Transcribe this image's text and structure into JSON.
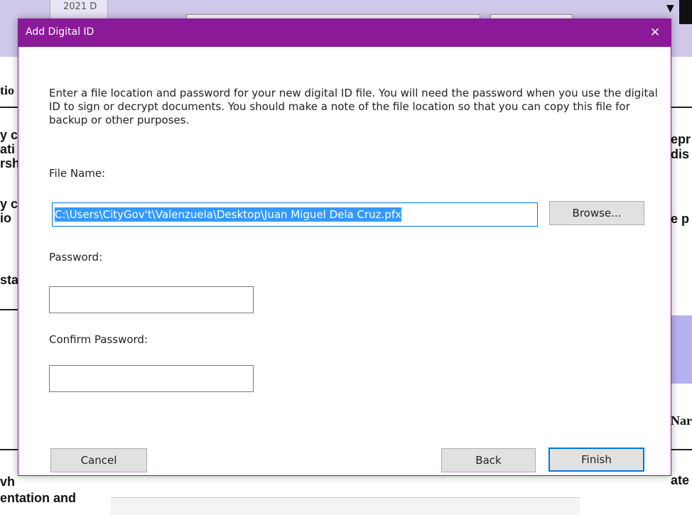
{
  "background": {
    "tab_label": "2021 D",
    "fragments_left": [
      "tio",
      "y c",
      "ati",
      "rsh",
      "y c",
      "io",
      "sta",
      "vh",
      "entation and"
    ],
    "fragments_right": [
      "epr",
      "dis",
      "e p",
      "Nar",
      "ate"
    ]
  },
  "dialog": {
    "title": "Add Digital ID",
    "close_glyph": "✕",
    "instructions": "Enter a file location and password for your new digital ID file. You will need the password when you use the digital ID to sign or decrypt documents. You should make a note of the file location so that you can copy this file for backup or other purposes.",
    "file_name_label": "File Name:",
    "file_name_value": "C:\\Users\\CityGov't\\Valenzuela\\Desktop\\Juan Miguel Dela Cruz.pfx",
    "browse_label": "Browse...",
    "password_label": "Password:",
    "password_value": "",
    "confirm_password_label": "Confirm Password:",
    "confirm_password_value": "",
    "cancel_label": "Cancel",
    "back_label": "Back",
    "finish_label": "Finish"
  },
  "colors": {
    "titlebar": "#8b1a99",
    "selection": "#3399ff",
    "focus_border": "#0078d7",
    "button_face": "#e1e1e1"
  }
}
